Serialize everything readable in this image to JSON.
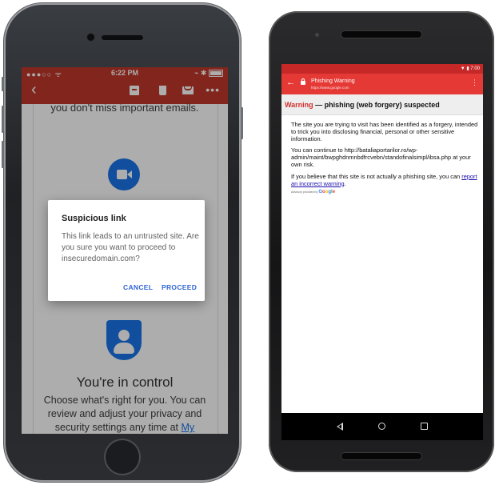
{
  "iphone": {
    "status": {
      "carrier": "●●●○○ ᯤ",
      "time": "6:22 PM",
      "right": "⌁ ✱"
    },
    "toolbar": {
      "back": "‹",
      "more": "•••"
    },
    "email": {
      "top_text": "you don't miss important emails.",
      "control_title": "You're in control",
      "control_text": "Choose what's right for you. You can review and adjust your privacy and security settings any time at",
      "control_link": "My"
    },
    "dialog": {
      "title": "Suspicious link",
      "message": "This link leads to an untrusted site. Are you sure you want to proceed to insecuredomain.com?",
      "cancel": "CANCEL",
      "proceed": "PROCEED"
    }
  },
  "android": {
    "status": {
      "right": "▼ ▮ 7:00"
    },
    "toolbar": {
      "back": "←",
      "title": "Phishing Warning",
      "url": "https://www.google.com",
      "more": "⋮"
    },
    "warning": {
      "label": "Warning",
      "rest": " — phishing (web forgery) suspected"
    },
    "content": {
      "p1": "The site you are trying to visit has been identified as a forgery, intended to trick you into disclosing financial, personal or other sensitive information.",
      "p2": "You can continue to http://bataliaportarilor.ro/wp-admin/maint/bwpghdnmnbdfrcvebn/standofinalsimpl/ibsa.php at your own risk.",
      "p3": "If you believe that this site is not actually a phishing site, you can",
      "p3_link": "report an incorrect warning",
      "p3_end": ".",
      "advisory_prefix": "Advisory provided by",
      "advisory_brand": [
        "G",
        "o",
        "o",
        "g",
        "l",
        "e"
      ]
    }
  },
  "colors": {
    "gmail_red": "#c0392b",
    "android_red": "#e53935",
    "link_blue": "#1a73e8",
    "dialog_button": "#3367d6",
    "warning_red": "#d32f2f"
  }
}
